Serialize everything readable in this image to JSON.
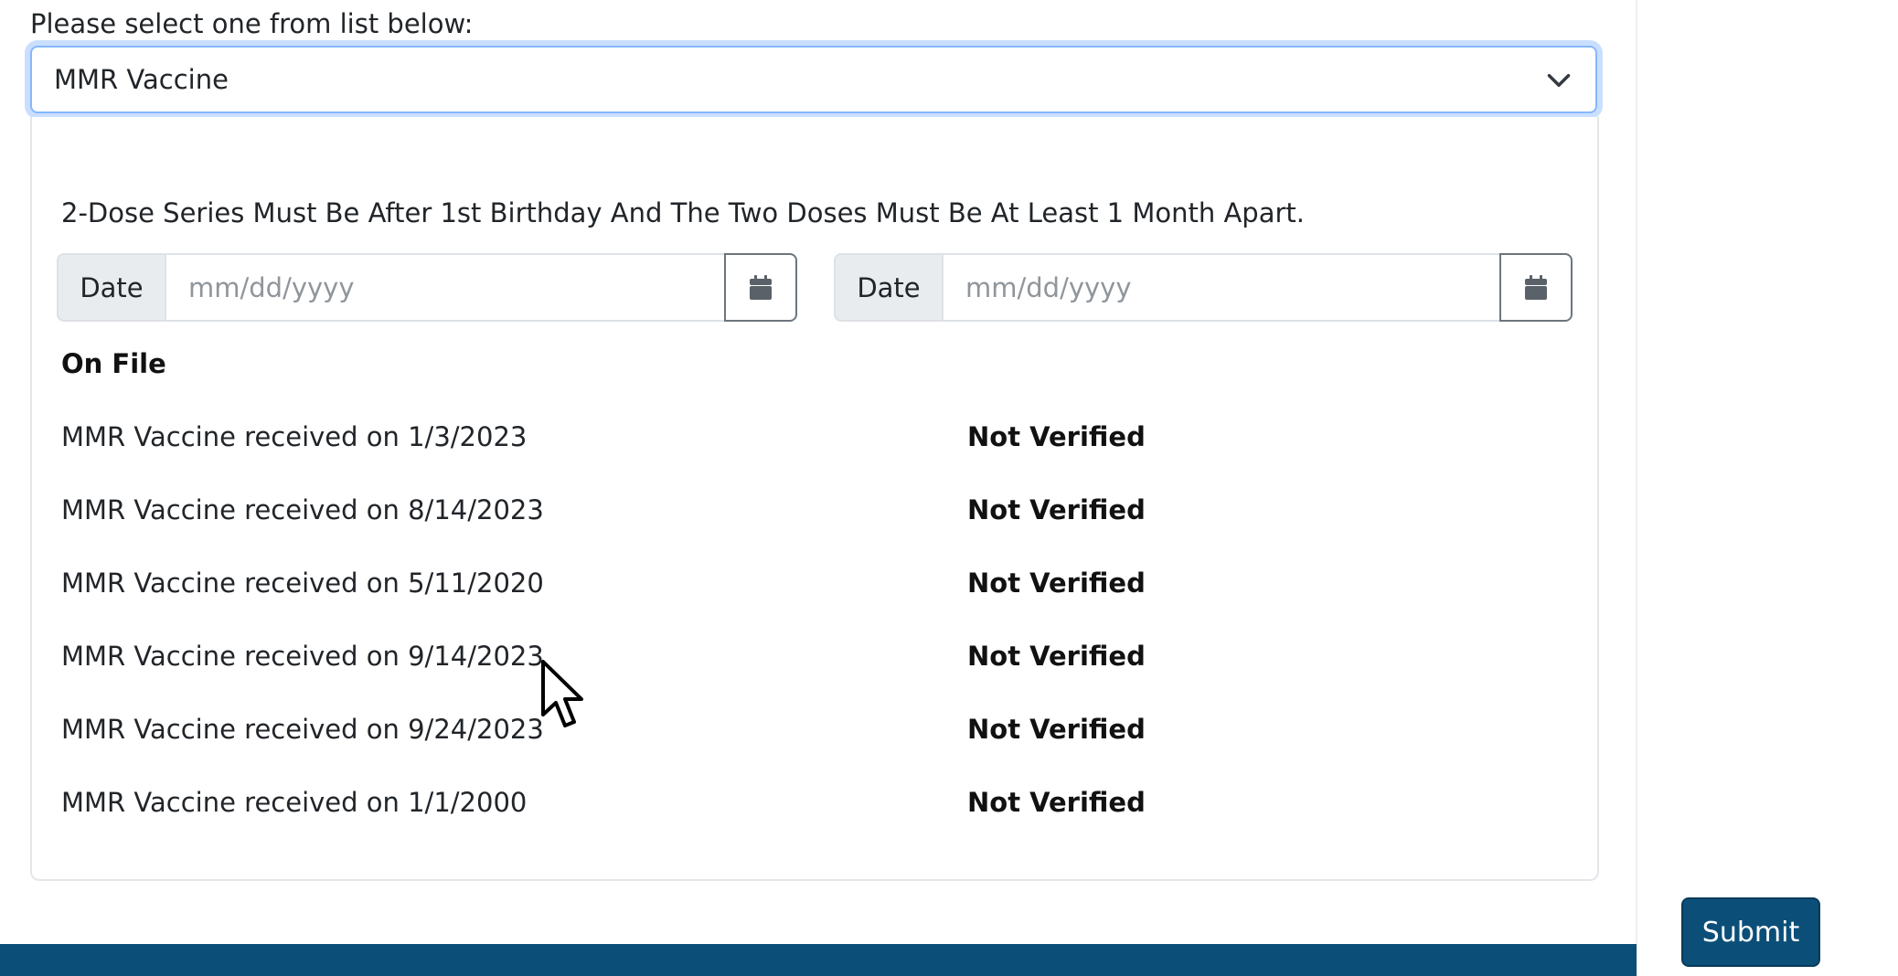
{
  "form": {
    "select_label": "Please select one from list below:",
    "selected_vaccine": "MMR Vaccine"
  },
  "requirement": {
    "instructions": "2-Dose Series Must Be After 1st Birthday And The Two Doses Must Be At Least 1 Month Apart.",
    "date_inputs": [
      {
        "label": "Date",
        "placeholder": "mm/dd/yyyy",
        "icon": "calendar-icon"
      },
      {
        "label": "Date",
        "placeholder": "mm/dd/yyyy",
        "icon": "calendar-icon"
      }
    ]
  },
  "on_file": {
    "title": "On File",
    "records": [
      {
        "description": "MMR Vaccine received on 1/3/2023",
        "status": "Not Verified"
      },
      {
        "description": "MMR Vaccine received on 8/14/2023",
        "status": "Not Verified"
      },
      {
        "description": "MMR Vaccine received on 5/11/2020",
        "status": "Not Verified"
      },
      {
        "description": "MMR Vaccine received on 9/14/2023",
        "status": "Not Verified"
      },
      {
        "description": "MMR Vaccine received on 9/24/2023",
        "status": "Not Verified"
      },
      {
        "description": "MMR Vaccine received on 1/1/2000",
        "status": "Not Verified"
      }
    ]
  },
  "actions": {
    "submit_label": "Submit"
  },
  "colors": {
    "primary": "#0b4f79",
    "focus_ring": "#86b7fe",
    "input_group_bg": "#e9ecef"
  }
}
